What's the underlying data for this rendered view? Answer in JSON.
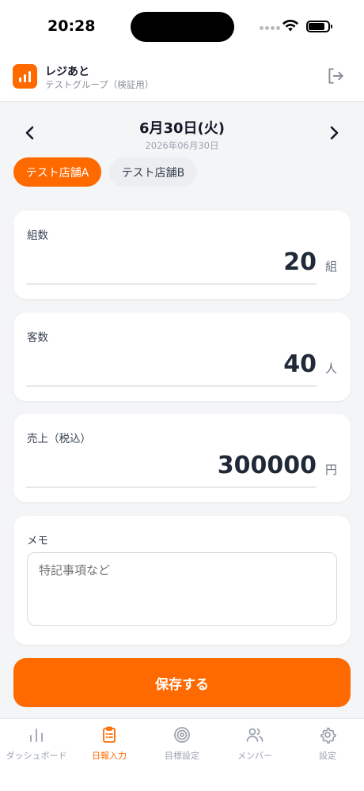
{
  "status_bar": {
    "time": "20:28"
  },
  "header": {
    "app_name": "レジあと",
    "group_name": "テストグループ（検証用）"
  },
  "date_nav": {
    "date_label": "6月30日(火)",
    "date_full": "2026年06月30日"
  },
  "store_tabs": [
    {
      "label": "テスト店舗A",
      "active": true
    },
    {
      "label": "テスト店舗B",
      "active": false
    }
  ],
  "fields": {
    "groups": {
      "label": "組数",
      "value": "20",
      "unit": "組"
    },
    "customers": {
      "label": "客数",
      "value": "40",
      "unit": "人"
    },
    "sales": {
      "label": "売上（税込）",
      "value": "300000",
      "unit": "円"
    }
  },
  "memo": {
    "label": "メモ",
    "placeholder": "特記事項など",
    "value": ""
  },
  "save_button": {
    "label": "保存する"
  },
  "bottom_nav": [
    {
      "label": "ダッシュボード",
      "icon": "chart-icon",
      "active": false
    },
    {
      "label": "日報入力",
      "icon": "clipboard-icon",
      "active": true
    },
    {
      "label": "目標設定",
      "icon": "target-icon",
      "active": false
    },
    {
      "label": "メンバー",
      "icon": "users-icon",
      "active": false
    },
    {
      "label": "設定",
      "icon": "gear-icon",
      "active": false
    }
  ],
  "colors": {
    "accent": "#ff6a00",
    "background": "#f4f5f7",
    "card": "#ffffff"
  }
}
